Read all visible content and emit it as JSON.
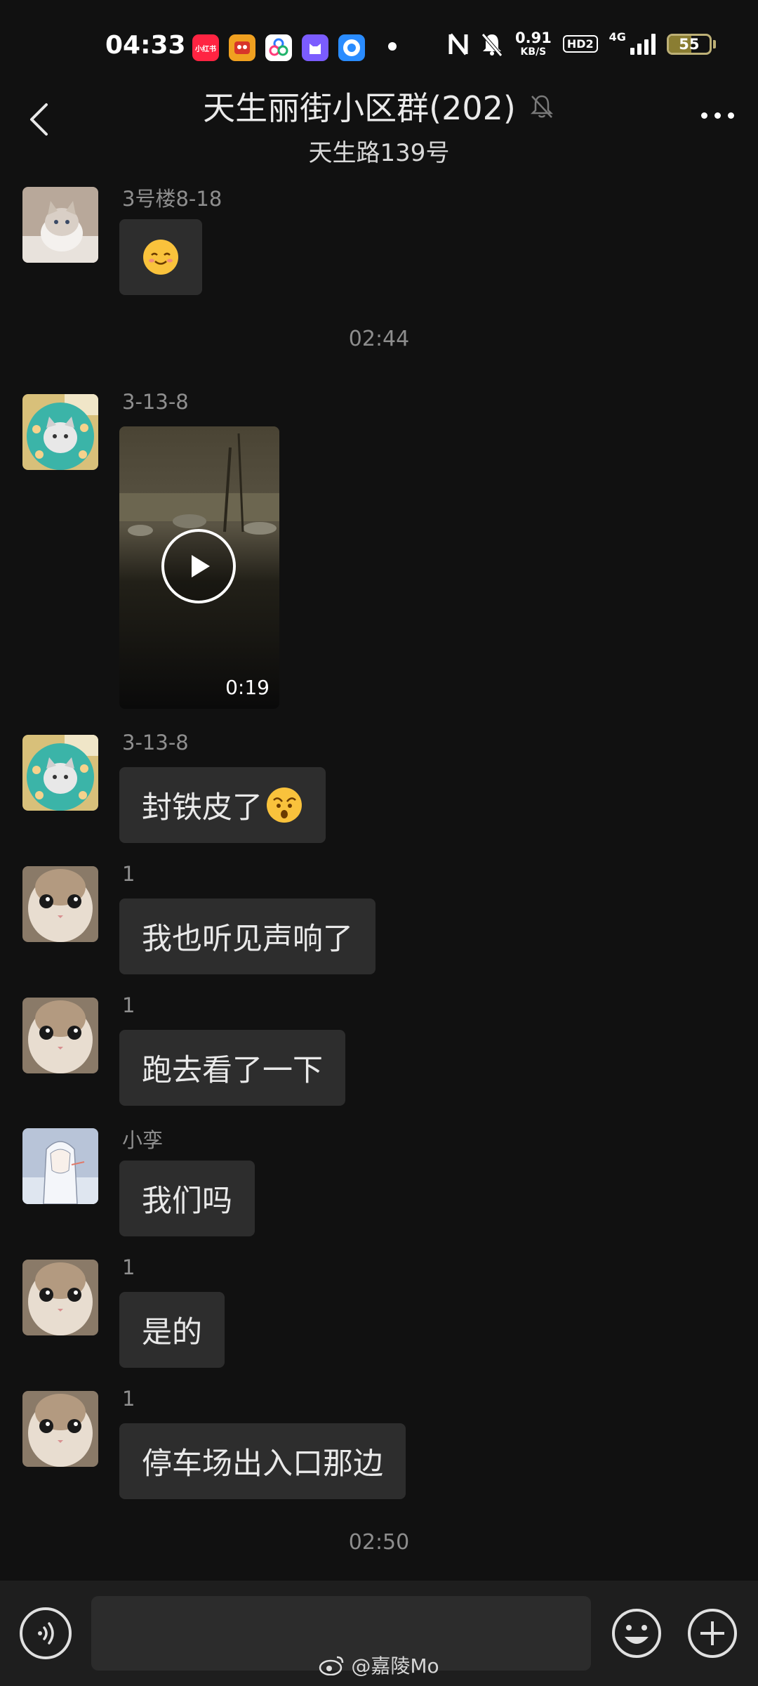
{
  "status_bar": {
    "time": "04:33",
    "apps": [
      {
        "name": "xiaohongshu-icon",
        "label": "小红书",
        "color": "#ff2442"
      },
      {
        "name": "game-app-icon",
        "label": "",
        "color": "#f0a020"
      },
      {
        "name": "cluster-app-icon",
        "label": "",
        "color": "#ffffff"
      },
      {
        "name": "cat-app-icon",
        "label": "",
        "color": "#7b5cff"
      },
      {
        "name": "ring-app-icon",
        "label": "",
        "color": "#2a8cff"
      }
    ],
    "net_speed_value": "0.91",
    "net_speed_unit": "KB/S",
    "hd_label": "HD2",
    "network_label": "4G",
    "battery_level": "55"
  },
  "header": {
    "title": "天生丽街小区群(202)",
    "subtitle": "天生路139号"
  },
  "messages": [
    {
      "sender": "3号楼8-18",
      "type": "emoji"
    },
    {
      "type": "time",
      "text": "02:44"
    },
    {
      "sender": "3-13-8",
      "type": "video",
      "duration": "0:19"
    },
    {
      "sender": "3-13-8",
      "type": "text",
      "text": "封铁皮了"
    },
    {
      "sender": "1",
      "type": "text",
      "text": "我也听见声响了"
    },
    {
      "sender": "1",
      "type": "text",
      "text": "跑去看了一下"
    },
    {
      "sender": "小孪",
      "type": "text",
      "text": "我们吗"
    },
    {
      "sender": "1",
      "type": "text",
      "text": "是的"
    },
    {
      "sender": "1",
      "type": "text",
      "text": "停车场出入口那边"
    },
    {
      "type": "time",
      "text": "02:50"
    }
  ],
  "input": {
    "placeholder": ""
  },
  "watermark": "@嘉陵Mo",
  "colors": {
    "background": "#111111",
    "bubble": "#2d2d2d",
    "input_bar": "#1e1e1e"
  }
}
